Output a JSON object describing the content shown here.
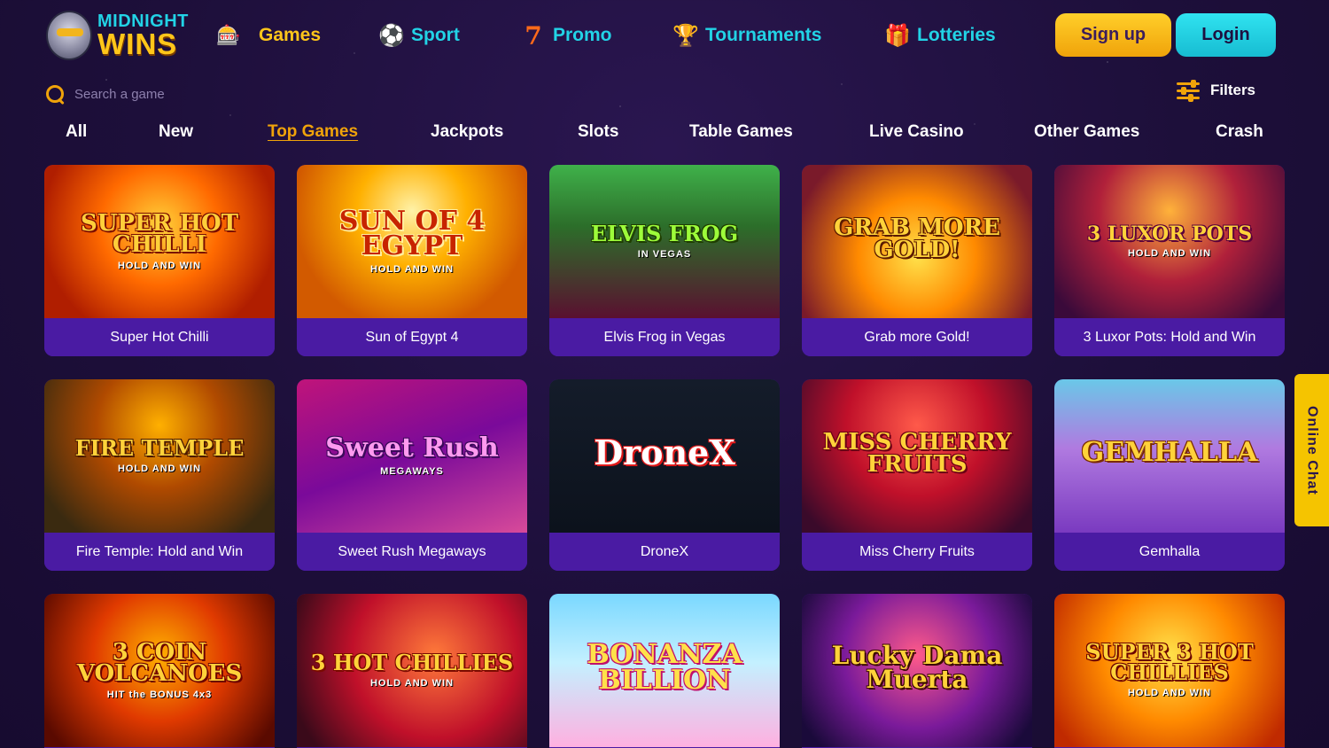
{
  "brand": {
    "line1": "MIDNIGHT",
    "line2": "WINS"
  },
  "nav": [
    {
      "label": "Games",
      "icon": "slot-machine-icon",
      "glyph": "🎰",
      "active": true
    },
    {
      "label": "Sport",
      "icon": "soccer-ball-icon",
      "glyph": "⚽"
    },
    {
      "label": "Promo",
      "icon": "lucky-seven-icon",
      "glyph": "7"
    },
    {
      "label": "Tournaments",
      "icon": "trophy-icon",
      "glyph": "🏆"
    },
    {
      "label": "Lotteries",
      "icon": "gift-box-icon",
      "glyph": "🎁"
    }
  ],
  "auth": {
    "signup_label": "Sign up",
    "login_label": "Login"
  },
  "search": {
    "placeholder": "Search a game"
  },
  "filters": {
    "label": "Filters"
  },
  "tabs": [
    "All",
    "New",
    "Top Games",
    "Jackpots",
    "Slots",
    "Table Games",
    "Live Casino",
    "Other Games",
    "Crash"
  ],
  "active_tab": "Top Games",
  "games": [
    {
      "name": "Super Hot Chilli",
      "art": "SUPER HOT CHILLI",
      "sub": "HOLD AND WIN"
    },
    {
      "name": "Sun of Egypt 4",
      "art": "SUN OF 4 EGYPT",
      "sub": "HOLD AND WIN"
    },
    {
      "name": "Elvis Frog in Vegas",
      "art": "ELVIS FROG",
      "sub": "IN VEGAS"
    },
    {
      "name": "Grab more Gold!",
      "art": "GRAB MORE GOLD!",
      "sub": ""
    },
    {
      "name": "3 Luxor Pots: Hold and Win",
      "art": "3 LUXOR POTS",
      "sub": "HOLD AND WIN"
    },
    {
      "name": "Fire Temple: Hold and Win",
      "art": "FIRE TEMPLE",
      "sub": "HOLD AND WIN"
    },
    {
      "name": "Sweet Rush Megaways",
      "art": "Sweet Rush",
      "sub": "MEGAWAYS"
    },
    {
      "name": "DroneX",
      "art": "DroneX",
      "sub": ""
    },
    {
      "name": "Miss Cherry Fruits",
      "art": "MISS CHERRY FRUITS",
      "sub": ""
    },
    {
      "name": "Gemhalla",
      "art": "GEMHALLA",
      "sub": ""
    },
    {
      "name": "3 Coin Volcanoes",
      "art": "3 COIN VOLCANOES",
      "sub": "HIT the BONUS 4x3"
    },
    {
      "name": "3 Hot Chillies",
      "art": "3 HOT CHILLIES",
      "sub": "HOLD AND WIN"
    },
    {
      "name": "Bonanza Billion",
      "art": "BONANZA BILLION",
      "sub": ""
    },
    {
      "name": "Lucky Dama Muerta",
      "art": "Lucky Dama Muerta",
      "sub": ""
    },
    {
      "name": "Super 3 Hot Chillies",
      "art": "SUPER 3 HOT CHILLIES",
      "sub": "HOLD AND WIN"
    }
  ],
  "chat": {
    "label": "Online Chat"
  },
  "colors": {
    "accent_yellow": "#ffc61a",
    "accent_cyan": "#22d3e6",
    "card_purple": "#4a1ba3",
    "background": "#1d0f3a"
  }
}
